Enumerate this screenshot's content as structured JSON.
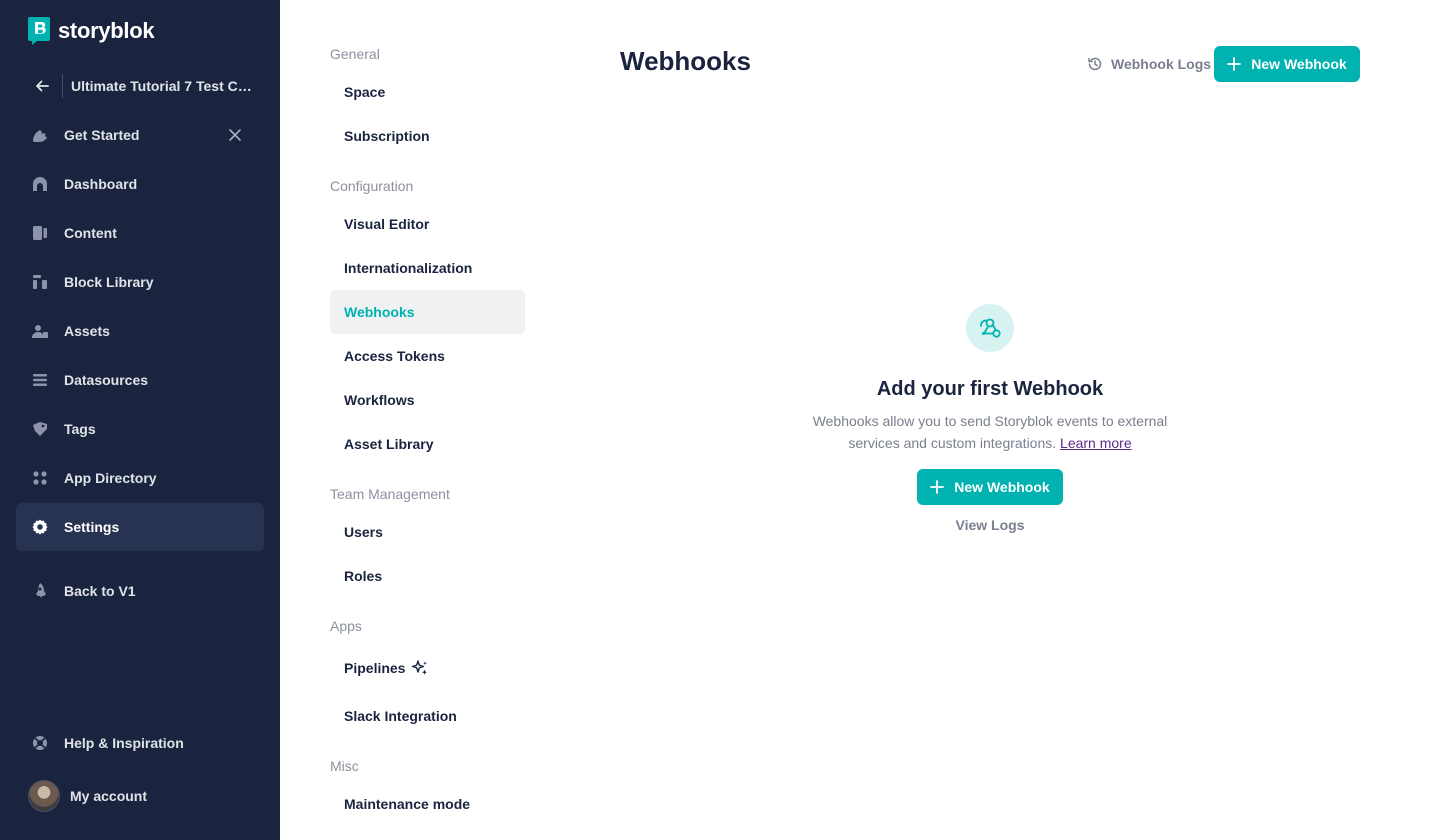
{
  "brand": {
    "name": "storyblok",
    "accent": "#00b3b0",
    "sidebar_bg": "#1b243f"
  },
  "sidebar": {
    "space_name": "Ultimate Tutorial 7 Test Ch...",
    "items": [
      {
        "label": "Get Started",
        "icon": "getting-started-icon",
        "closable": true
      },
      {
        "label": "Dashboard",
        "icon": "dashboard-icon"
      },
      {
        "label": "Content",
        "icon": "content-icon"
      },
      {
        "label": "Block Library",
        "icon": "block-library-icon"
      },
      {
        "label": "Assets",
        "icon": "assets-icon"
      },
      {
        "label": "Datasources",
        "icon": "datasources-icon"
      },
      {
        "label": "Tags",
        "icon": "tag-icon"
      },
      {
        "label": "App Directory",
        "icon": "apps-icon"
      },
      {
        "label": "Settings",
        "icon": "gear-icon",
        "active": true
      },
      {
        "label": "Back to V1",
        "icon": "rocket-icon"
      }
    ],
    "help": {
      "label": "Help & Inspiration",
      "icon": "lifebuoy-icon"
    },
    "account": {
      "label": "My account"
    }
  },
  "settings_nav": {
    "sections": [
      {
        "title": "General",
        "items": [
          "Space",
          "Subscription"
        ]
      },
      {
        "title": "Configuration",
        "items": [
          "Visual Editor",
          "Internationalization",
          "Webhooks",
          "Access Tokens",
          "Workflows",
          "Asset Library"
        ]
      },
      {
        "title": "Team Management",
        "items": [
          "Users",
          "Roles"
        ]
      },
      {
        "title": "Apps",
        "items": [
          "Pipelines",
          "Slack Integration"
        ]
      },
      {
        "title": "Misc",
        "items": [
          "Maintenance mode"
        ]
      }
    ],
    "active": "Webhooks"
  },
  "main": {
    "title": "Webhooks",
    "logs_link": "Webhook Logs",
    "new_button": "New Webhook",
    "empty": {
      "icon": "webhook-icon",
      "title": "Add your first Webhook",
      "description": "Webhooks allow you to send Storyblok events to external services and custom integrations.",
      "learn_more": "Learn more",
      "button": "New Webhook",
      "view_logs": "View Logs"
    }
  }
}
